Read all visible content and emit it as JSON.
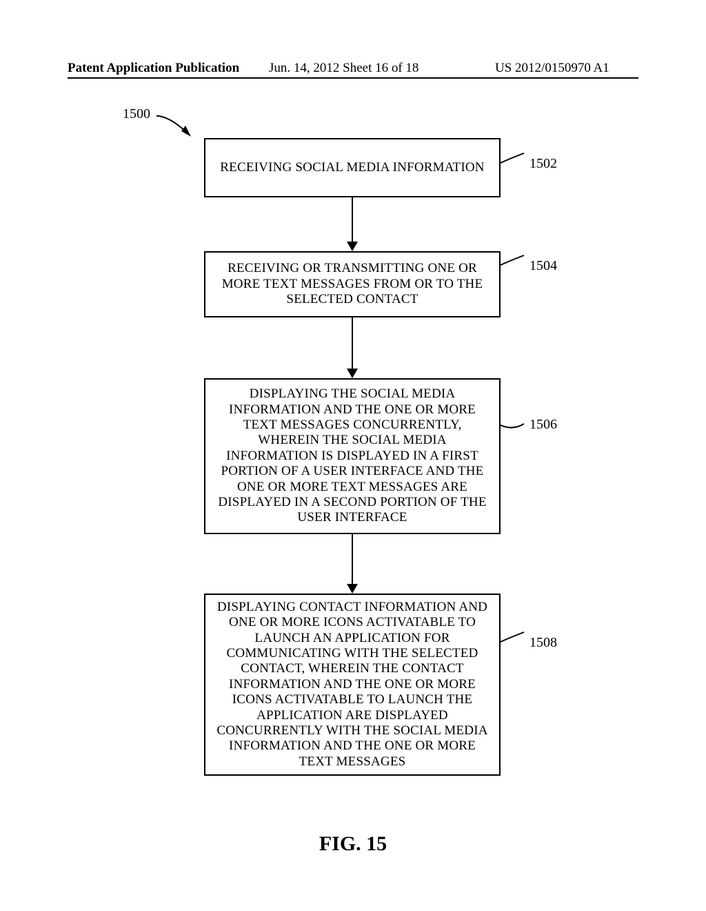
{
  "header": {
    "left": "Patent Application Publication",
    "mid": "Jun. 14, 2012  Sheet 16 of 18",
    "right": "US 2012/0150970 A1"
  },
  "flowchart": {
    "ref_root": "1500",
    "boxes": {
      "b1": {
        "ref": "1502",
        "text": "RECEIVING SOCIAL MEDIA INFORMATION"
      },
      "b2": {
        "ref": "1504",
        "text": "RECEIVING OR TRANSMITTING ONE OR MORE TEXT MESSAGES FROM OR TO THE SELECTED CONTACT"
      },
      "b3": {
        "ref": "1506",
        "text": "DISPLAYING THE SOCIAL MEDIA INFORMATION AND THE ONE OR MORE TEXT MESSAGES CONCURRENTLY, WHEREIN THE SOCIAL MEDIA INFORMATION IS DISPLAYED IN A FIRST PORTION OF A USER INTERFACE AND THE ONE OR MORE TEXT MESSAGES ARE DISPLAYED IN A SECOND PORTION OF THE USER INTERFACE"
      },
      "b4": {
        "ref": "1508",
        "text": "DISPLAYING CONTACT INFORMATION AND ONE OR MORE ICONS ACTIVATABLE TO LAUNCH AN APPLICATION FOR COMMUNICATING WITH THE SELECTED CONTACT, WHEREIN THE CONTACT INFORMATION AND THE ONE OR MORE ICONS ACTIVATABLE TO LAUNCH THE APPLICATION ARE DISPLAYED CONCURRENTLY WITH THE SOCIAL MEDIA INFORMATION AND THE ONE OR MORE TEXT MESSAGES"
      }
    }
  },
  "figure_caption": "FIG. 15"
}
